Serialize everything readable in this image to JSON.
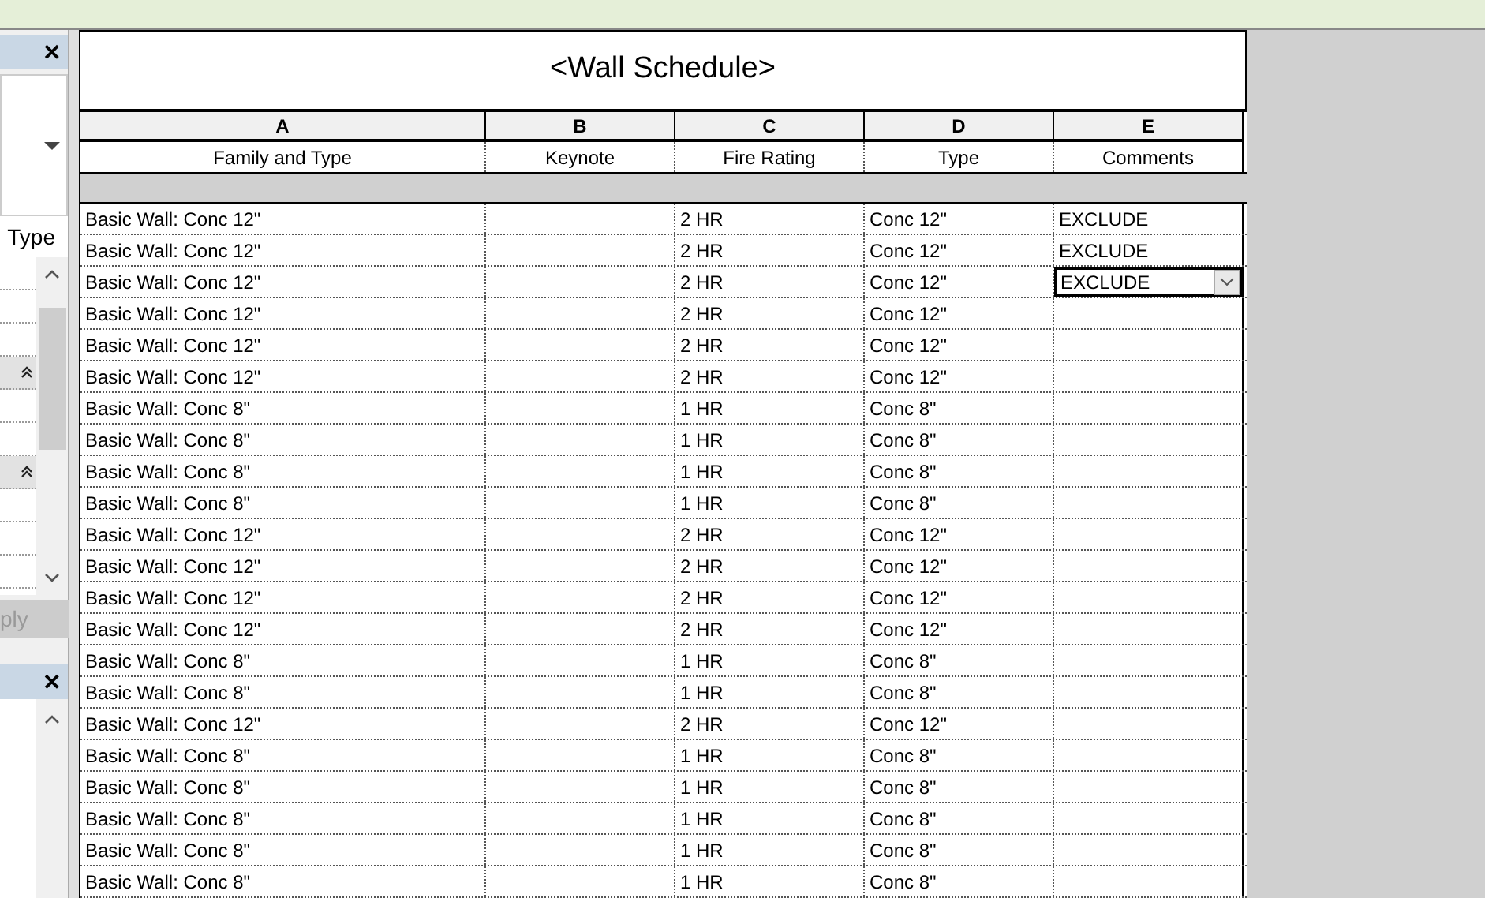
{
  "properties_panel": {
    "close": "✕",
    "type_label": "Type",
    "apply_button": {
      "label": "ply",
      "disabled": true
    }
  },
  "browser_panel": {
    "close": "✕"
  },
  "schedule": {
    "title": "<Wall Schedule>",
    "column_letters": [
      "A",
      "B",
      "C",
      "D",
      "E"
    ],
    "columns": [
      "Family and Type",
      "Keynote",
      "Fire Rating",
      "Type",
      "Comments"
    ],
    "rows": [
      {
        "cells": [
          "Basic Wall: Conc 12\"",
          "",
          "2 HR",
          "Conc 12\"",
          "EXCLUDE"
        ],
        "editing": false
      },
      {
        "cells": [
          "Basic Wall: Conc 12\"",
          "",
          "2 HR",
          "Conc 12\"",
          "EXCLUDE"
        ],
        "editing": false
      },
      {
        "cells": [
          "Basic Wall: Conc 12\"",
          "",
          "2 HR",
          "Conc 12\"",
          "EXCLUDE"
        ],
        "editing": true
      },
      {
        "cells": [
          "Basic Wall: Conc 12\"",
          "",
          "2 HR",
          "Conc 12\"",
          ""
        ],
        "editing": false
      },
      {
        "cells": [
          "Basic Wall: Conc 12\"",
          "",
          "2 HR",
          "Conc 12\"",
          ""
        ],
        "editing": false
      },
      {
        "cells": [
          "Basic Wall: Conc 12\"",
          "",
          "2 HR",
          "Conc 12\"",
          ""
        ],
        "editing": false
      },
      {
        "cells": [
          "Basic Wall: Conc 8\"",
          "",
          "1 HR",
          "Conc 8\"",
          ""
        ],
        "editing": false
      },
      {
        "cells": [
          "Basic Wall: Conc 8\"",
          "",
          "1 HR",
          "Conc 8\"",
          ""
        ],
        "editing": false
      },
      {
        "cells": [
          "Basic Wall: Conc 8\"",
          "",
          "1 HR",
          "Conc 8\"",
          ""
        ],
        "editing": false
      },
      {
        "cells": [
          "Basic Wall: Conc 8\"",
          "",
          "1 HR",
          "Conc 8\"",
          ""
        ],
        "editing": false
      },
      {
        "cells": [
          "Basic Wall: Conc 12\"",
          "",
          "2 HR",
          "Conc 12\"",
          ""
        ],
        "editing": false
      },
      {
        "cells": [
          "Basic Wall: Conc 12\"",
          "",
          "2 HR",
          "Conc 12\"",
          ""
        ],
        "editing": false
      },
      {
        "cells": [
          "Basic Wall: Conc 12\"",
          "",
          "2 HR",
          "Conc 12\"",
          ""
        ],
        "editing": false
      },
      {
        "cells": [
          "Basic Wall: Conc 12\"",
          "",
          "2 HR",
          "Conc 12\"",
          ""
        ],
        "editing": false
      },
      {
        "cells": [
          "Basic Wall: Conc 8\"",
          "",
          "1 HR",
          "Conc 8\"",
          ""
        ],
        "editing": false
      },
      {
        "cells": [
          "Basic Wall: Conc 8\"",
          "",
          "1 HR",
          "Conc 8\"",
          ""
        ],
        "editing": false
      },
      {
        "cells": [
          "Basic Wall: Conc 12\"",
          "",
          "2 HR",
          "Conc 12\"",
          ""
        ],
        "editing": false
      },
      {
        "cells": [
          "Basic Wall: Conc 8\"",
          "",
          "1 HR",
          "Conc 8\"",
          ""
        ],
        "editing": false
      },
      {
        "cells": [
          "Basic Wall: Conc 8\"",
          "",
          "1 HR",
          "Conc 8\"",
          ""
        ],
        "editing": false
      },
      {
        "cells": [
          "Basic Wall: Conc 8\"",
          "",
          "1 HR",
          "Conc 8\"",
          ""
        ],
        "editing": false
      },
      {
        "cells": [
          "Basic Wall: Conc 8\"",
          "",
          "1 HR",
          "Conc 8\"",
          ""
        ],
        "editing": false
      },
      {
        "cells": [
          "Basic Wall: Conc 8\"",
          "",
          "1 HR",
          "Conc 8\"",
          ""
        ],
        "editing": false
      }
    ]
  }
}
